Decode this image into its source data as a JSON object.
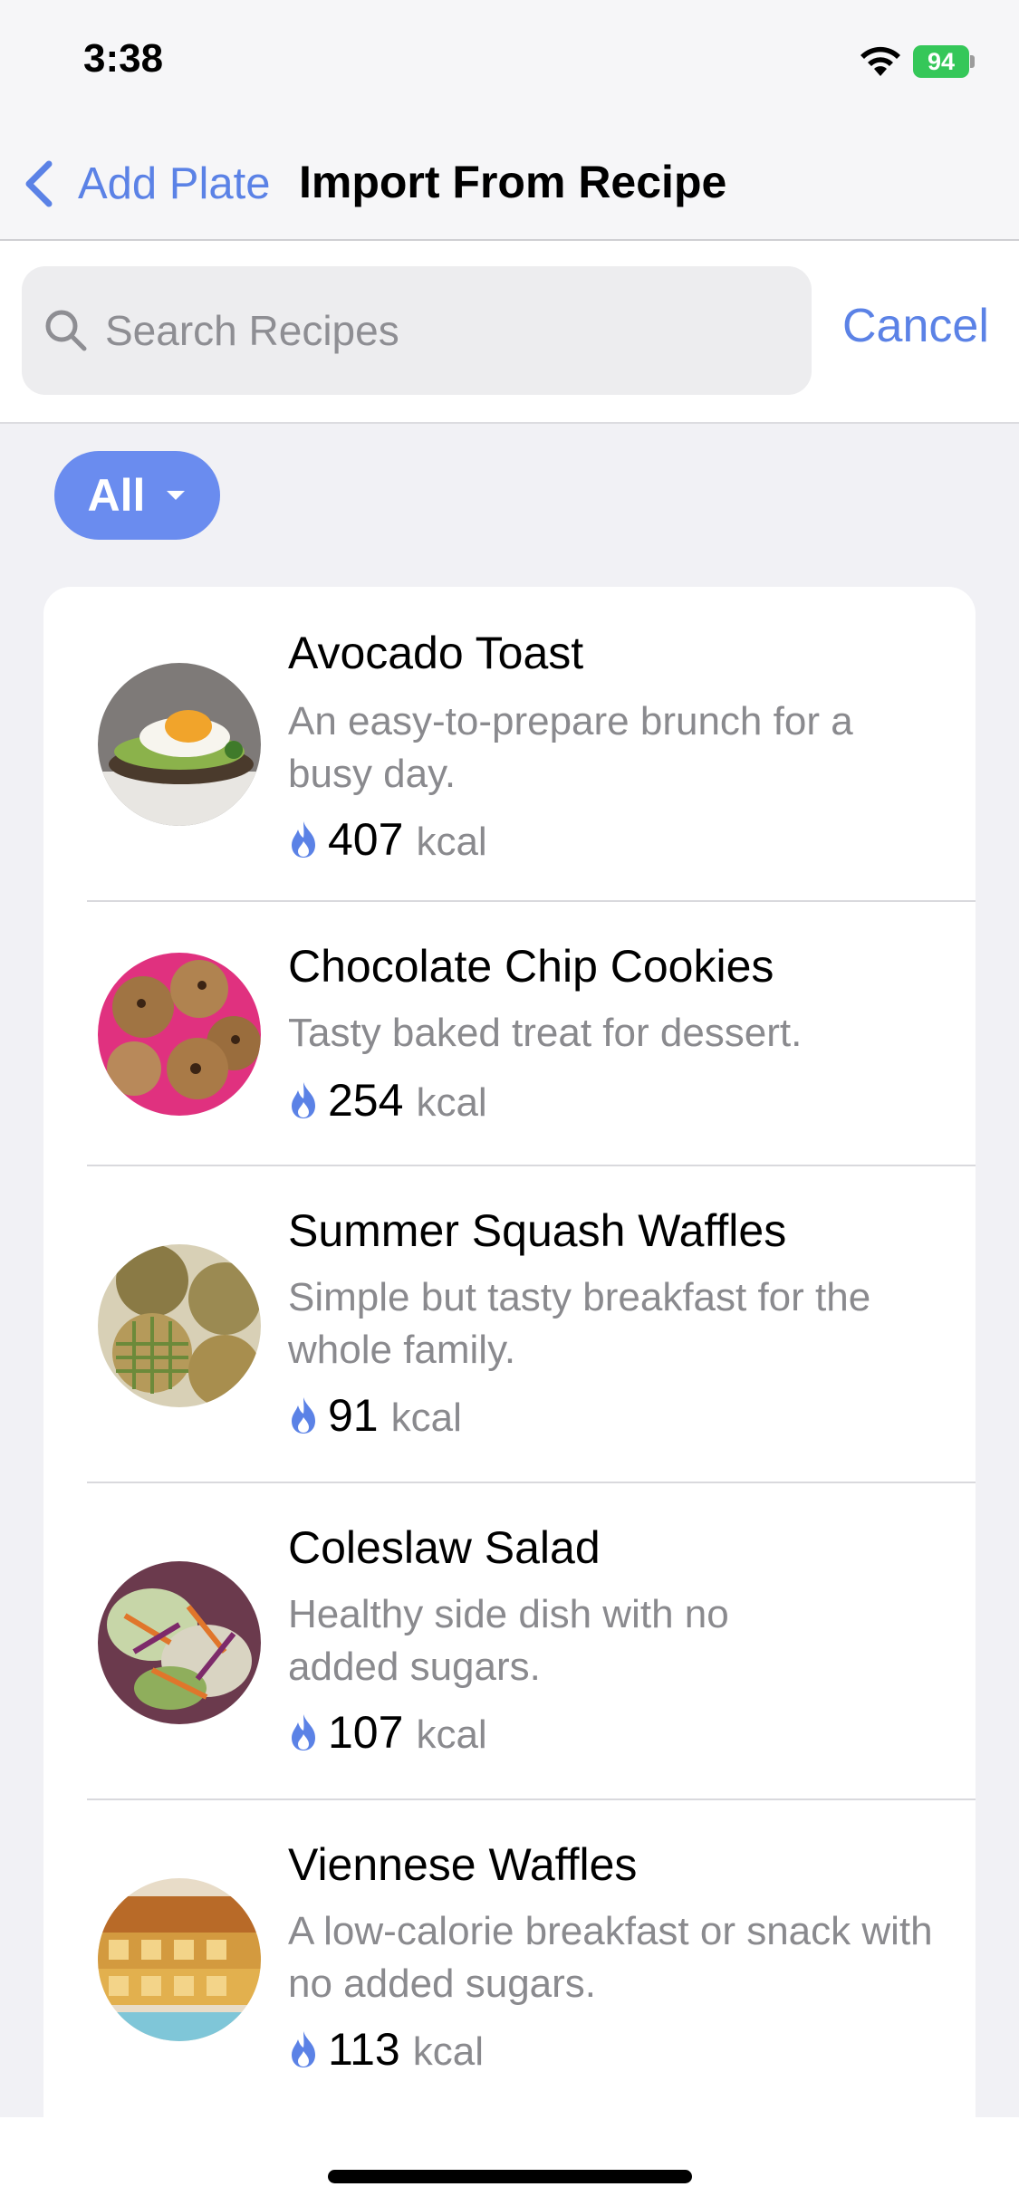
{
  "status_bar": {
    "time": "3:38",
    "battery": "94"
  },
  "nav": {
    "back_label": "Add Plate",
    "title": "Import From Recipe"
  },
  "search": {
    "placeholder": "Search Recipes",
    "value": "",
    "cancel_label": "Cancel"
  },
  "filter": {
    "selected": "All"
  },
  "colors": {
    "accent": "#5b82e6",
    "chip": "#6a8cef",
    "flame": "#5b82e6"
  },
  "recipes": [
    {
      "name": "Avocado Toast",
      "description": "An easy-to-prepare brunch for a busy day.",
      "kcal": "407",
      "unit": "kcal",
      "thumb": "avocado-toast-photo"
    },
    {
      "name": "Chocolate Chip Cookies",
      "description": "Tasty baked treat for dessert.",
      "kcal": "254",
      "unit": "kcal",
      "thumb": "cookies-photo"
    },
    {
      "name": "Summer Squash Waffles",
      "description": "Simple but tasty breakfast for the whole family.",
      "kcal": "91",
      "unit": "kcal",
      "thumb": "squash-waffles-photo"
    },
    {
      "name": "Coleslaw Salad",
      "description": "Healthy side dish with no added sugars.",
      "kcal": "107",
      "unit": "kcal",
      "thumb": "coleslaw-photo"
    },
    {
      "name": "Viennese Waffles",
      "description": "A low-calorie breakfast or snack with no added sugars.",
      "kcal": "113",
      "unit": "kcal",
      "thumb": "viennese-waffles-photo"
    }
  ]
}
